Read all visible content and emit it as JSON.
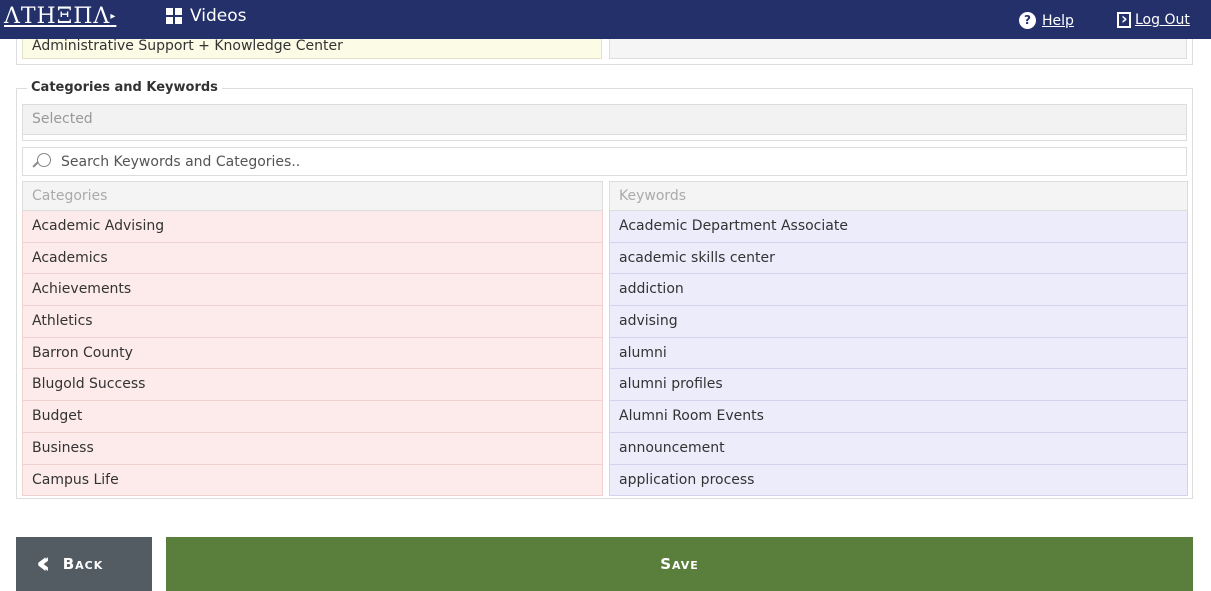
{
  "header": {
    "logo_text": "ΛΤΗΞΠΛ",
    "nav_videos_label": "Videos",
    "help_label": "Help",
    "logout_label": "Log Out"
  },
  "top_fields": {
    "department_value": "Administrative Support + Knowledge Center"
  },
  "categories_keywords": {
    "legend": "Categories and Keywords",
    "selected_placeholder": "Selected",
    "search_placeholder": "Search Keywords and Categories..",
    "categories_header": "Categories",
    "keywords_header": "Keywords",
    "categories": [
      "Academic Advising",
      "Academics",
      "Achievements",
      "Athletics",
      "Barron County",
      "Blugold Success",
      "Budget",
      "Business",
      "Campus Life"
    ],
    "keywords": [
      "Academic Department Associate",
      "academic skills center",
      "addiction",
      "advising",
      "alumni",
      "alumni profiles",
      "Alumni Room Events",
      "announcement",
      "application process"
    ]
  },
  "actions": {
    "back_label": "Back",
    "save_label": "Save"
  },
  "colors": {
    "topbar": "#24306a",
    "category_row": "#fcebea",
    "keyword_row": "#ececfb",
    "save_button": "#5a7f3c",
    "back_button": "#545c63"
  }
}
